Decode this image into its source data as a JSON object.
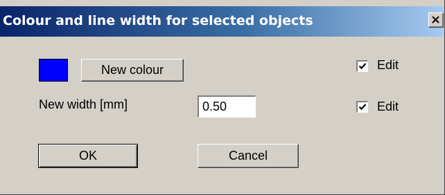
{
  "dialog": {
    "title": "Colour and line width for selected objects",
    "close_glyph": "close-icon"
  },
  "colour": {
    "swatch_color": "#0000ff",
    "new_colour_label": "New colour",
    "edit_label": "Edit",
    "edit_checked": true
  },
  "width": {
    "label": "New width [mm]",
    "value": "0.50",
    "edit_label": "Edit",
    "edit_checked": true
  },
  "buttons": {
    "ok_label": "OK",
    "cancel_label": "Cancel"
  },
  "colors": {
    "dialog_bg": "#d4d0c8",
    "title_start": "#0a246a",
    "title_end": "#a6caf0",
    "title_text": "#ffffff"
  }
}
